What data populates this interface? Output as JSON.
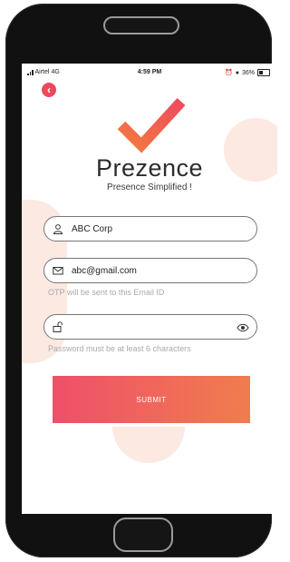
{
  "status_bar": {
    "carrier": "Airtel",
    "network": "4G",
    "time": "4:59 PM",
    "battery": "36%"
  },
  "header": {
    "back_icon": "chevron-left-icon",
    "app_name": "Prezence",
    "tagline": "Presence Simplified !"
  },
  "form": {
    "company": {
      "icon": "user-icon",
      "value": "ABC Corp"
    },
    "email": {
      "icon": "mail-icon",
      "value": "abc@gmail.com",
      "hint": "OTP will be sent to this Email ID"
    },
    "password": {
      "icon": "unlock-icon",
      "value": "",
      "toggle_icon": "eye-icon",
      "hint": "Password must be at least 6 characters"
    },
    "submit_label": "SUBMIT"
  },
  "colors": {
    "accent": "#ec4a5c",
    "gradient_start": "#ef4f6a",
    "gradient_end": "#f07d4e",
    "blob": "#fbe9e2"
  }
}
